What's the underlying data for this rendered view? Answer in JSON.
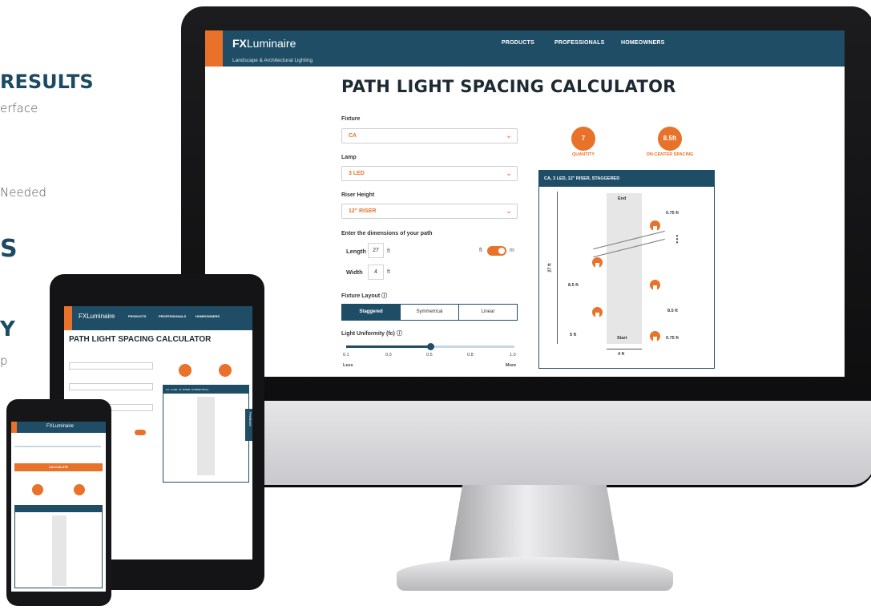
{
  "left_text": {
    "results": "RESULTS",
    "erface": "erface",
    "needed": "Needed",
    "s": "S",
    "y": "Y",
    "p": "p"
  },
  "app": {
    "brand_fx": "FX",
    "brand_name": "Luminaire",
    "tagline": "Landscape & Architectural Lighting",
    "nav": [
      "PRODUCTS",
      "PROFESSIONALS",
      "HOMEOWNERS"
    ],
    "title": "PATH LIGHT SPACING CALCULATOR",
    "fixture_label": "Fixture",
    "fixture_value": "CA",
    "lamp_label": "Lamp",
    "lamp_value": "3 LED",
    "riser_label": "Riser Height",
    "riser_value": "12\" RISER",
    "dims_label": "Enter the dimensions of your path",
    "length_label": "Length",
    "length_value": "27",
    "width_label": "Width",
    "width_value": "4",
    "unit_ft": "ft",
    "unit_m": "m",
    "layout_label": "Fixture Layout ⓘ",
    "layouts": [
      "Staggered",
      "Symmetrical",
      "Linear"
    ],
    "uniformity_label": "Light Uniformity (fc) ⓘ",
    "ticks": [
      "0.1",
      "0.3",
      "0.5",
      "0.8",
      "1.0"
    ],
    "less": "Less",
    "more": "More",
    "slider_fraction": 0.5,
    "quantity_value": "7",
    "quantity_label": "QUANTITY",
    "spacing_value": "8.5ft",
    "spacing_label": "ON-CENTER SPACING",
    "diagram_title": "CA, 3 LED, 12\" RISER, STAGGERED",
    "diag_end": "End",
    "diag_start": "Start",
    "diag_len": "27 ft",
    "diag_width": "4 ft",
    "diag_d1": "0.75 ft",
    "diag_d2": "8.5 ft",
    "diag_d3": "8.5 ft",
    "diag_d4": "5 ft",
    "diag_d5": "0.75 ft",
    "dots": "⋮"
  },
  "tablet": {
    "brand": "FXLuminaire",
    "nav": [
      "PRODUCTS",
      "PROFESSIONALS",
      "HOMEOWNERS"
    ],
    "title": "PATH LIGHT SPACING CALCULATOR",
    "diag_title": "CA, 3 LED, 12\" RISER, SYMMETRICAL",
    "side_tab": "Feedback"
  },
  "phone": {
    "brand": "FXLuminaire",
    "calc_btn": "CALCULATE"
  },
  "colors": {
    "navy": "#1f4d66",
    "orange": "#e8722a"
  }
}
